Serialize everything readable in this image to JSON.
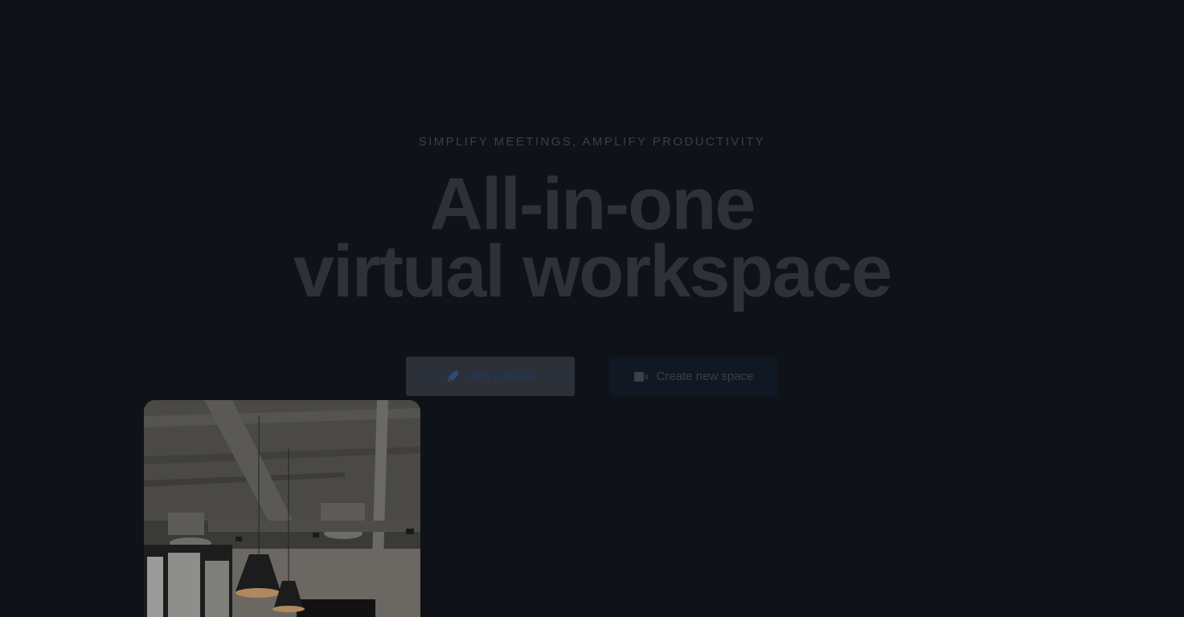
{
  "hero": {
    "eyebrow": "SIMPLIFY MEETINGS, AMPLIFY PRODUCTIVITY",
    "headline_line1": "All-in-one",
    "headline_line2": "virtual workspace"
  },
  "actions": {
    "join_label": "Join a space",
    "join_icon": "rocket-icon",
    "create_label": "Create new space",
    "create_icon": "video-camera-icon"
  },
  "media": {
    "photo_subject": "office-interior-with-pendant-lamps"
  },
  "colors": {
    "background": "#0f1217",
    "headline": "#2d3139",
    "join_button_bg": "#2b3039",
    "join_button_text": "#1f3b5c",
    "create_button_bg": "#101823"
  }
}
